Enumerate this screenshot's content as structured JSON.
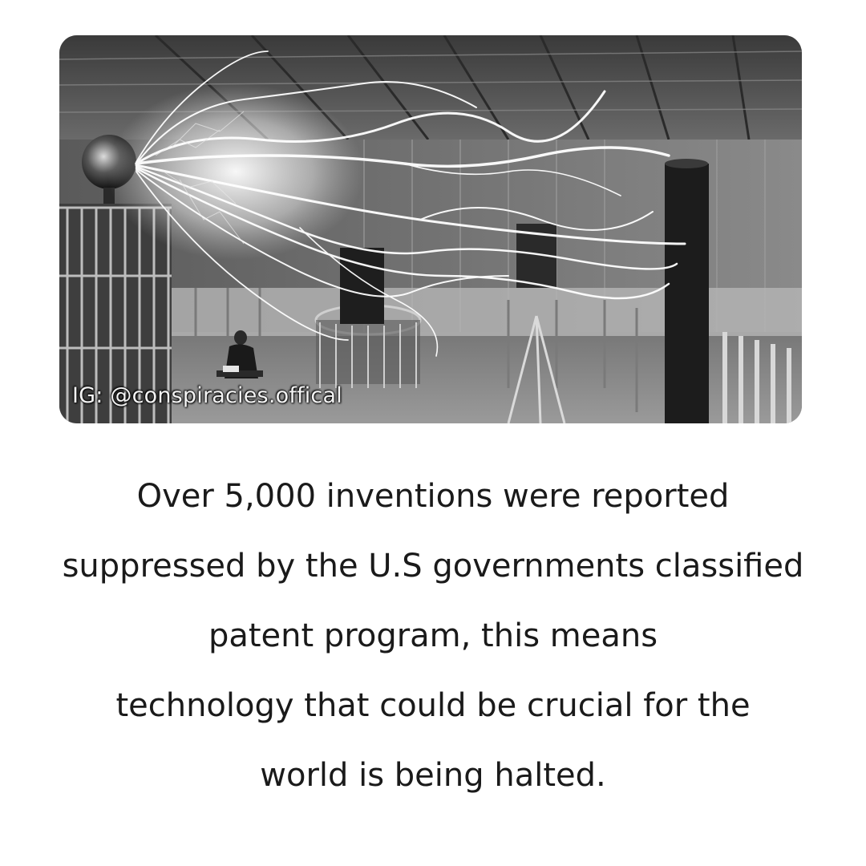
{
  "image": {
    "subject": "historical black-and-white photograph",
    "watermark": "IG: @conspiracies.offical"
  },
  "caption": {
    "lines": [
      "Over 5,000 inventions were reported",
      "suppressed by the U.S governments classified",
      "patent program, this means",
      "technology that could be crucial for the",
      "world is being halted."
    ]
  }
}
